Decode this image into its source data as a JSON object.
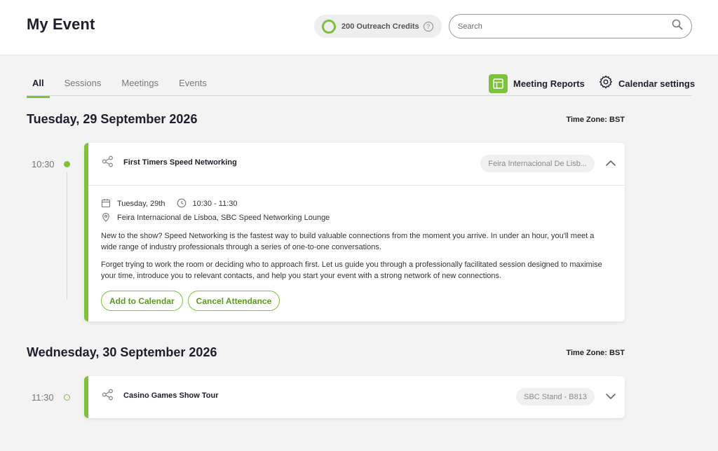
{
  "header": {
    "title": "My Event",
    "credits_label": "200 Outreach Credits",
    "credits_help": "?",
    "search_placeholder": "Search"
  },
  "tabs": [
    {
      "label": "All",
      "active": true
    },
    {
      "label": "Sessions",
      "active": false
    },
    {
      "label": "Meetings",
      "active": false
    },
    {
      "label": "Events",
      "active": false
    }
  ],
  "actions": {
    "meeting_reports": "Meeting Reports",
    "calendar_settings": "Calendar settings"
  },
  "days": [
    {
      "heading": "Tuesday, 29 September 2026",
      "timezone": "Time Zone: BST",
      "event": {
        "time": "10:30",
        "title": "First Timers Speed Networking",
        "location_chip": "Feira Internacional De Lisb...",
        "date": "Tuesday, 29th",
        "time_range": "10:30 - 11:30",
        "location": "Feira Internacional de Lisboa, SBC Speed Networking Lounge",
        "description_1": "New to the show? Speed Networking is the fastest way to build valuable connections from the moment you arrive. In under an hour, you'll meet a wide range of industry professionals through a series of one-to-one conversations.",
        "description_2": "Forget trying to work the room or deciding who to approach first. Let us guide you through a professionally facilitated session designed to maximise your time, introduce you to relevant contacts, and help you start your event with a strong network of new connections.",
        "add_to_calendar": "Add to Calendar",
        "cancel_attendance": "Cancel Attendance"
      }
    },
    {
      "heading": "Wednesday, 30 September 2026",
      "timezone": "Time Zone: BST",
      "event": {
        "time": "11:30",
        "title": "Casino Games Show Tour",
        "location_chip": "SBC Stand - B813"
      }
    }
  ],
  "colors": {
    "accent": "#7ec13c",
    "text_dark": "#1e1e2c",
    "background": "#f3f3f3"
  }
}
